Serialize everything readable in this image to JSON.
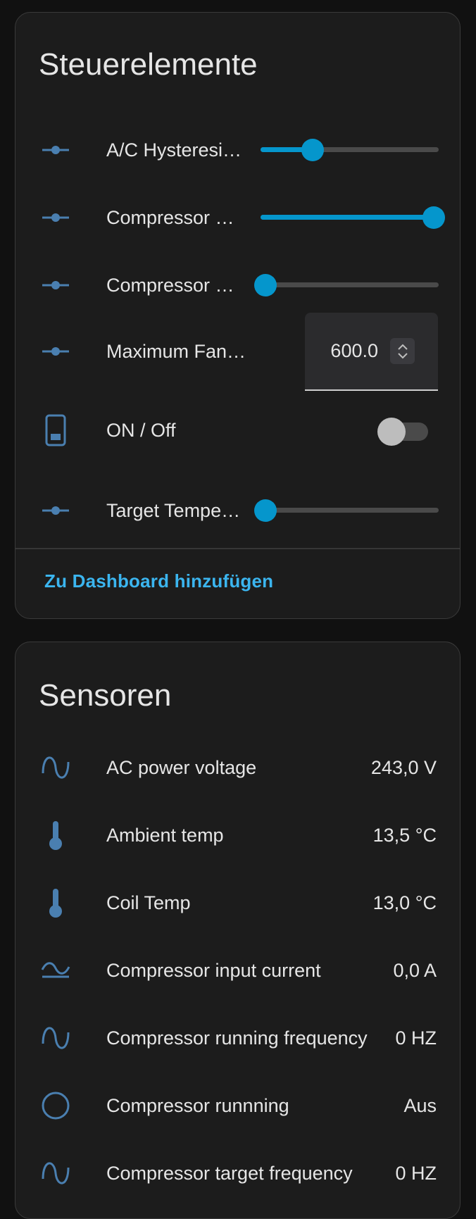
{
  "colors": {
    "accent": "#0596cc",
    "link": "#3bb5ef",
    "icon": "#4a7fb0",
    "card_bg": "#1c1c1c",
    "page_bg": "#111111"
  },
  "controls": {
    "title": "Steuerelemente",
    "items": [
      {
        "label": "A/C Hysteresi…",
        "type": "slider",
        "icon": "slider-icon",
        "level": 0.28
      },
      {
        "label": "Compressor …",
        "type": "slider",
        "icon": "slider-icon",
        "level": 1.0
      },
      {
        "label": "Compressor …",
        "type": "slider",
        "icon": "slider-icon",
        "level": 0.0
      },
      {
        "label": "Maximum Fan…",
        "type": "number",
        "icon": "slider-icon",
        "value": "600.0"
      },
      {
        "label": "ON / Off",
        "type": "toggle",
        "icon": "phone-icon",
        "state": "off"
      },
      {
        "label": "Target Tempe…",
        "type": "slider",
        "icon": "slider-icon",
        "level": 0.0
      }
    ],
    "action_label": "Zu Dashboard hinzufügen"
  },
  "sensors": {
    "title": "Sensoren",
    "items": [
      {
        "label": "AC power voltage",
        "value": "243,0 V",
        "icon": "sine-wave-icon"
      },
      {
        "label": "Ambient temp",
        "value": "13,5 °C",
        "icon": "thermometer-icon"
      },
      {
        "label": "Coil Temp",
        "value": "13,0 °C",
        "icon": "thermometer-icon"
      },
      {
        "label": "Compressor input current",
        "value": "0,0 A",
        "icon": "current-ac-icon"
      },
      {
        "label": "Compressor running frequency",
        "value": "0 HZ",
        "icon": "sine-wave-icon"
      },
      {
        "label": "Compressor runnning",
        "value": "Aus",
        "icon": "circle-outline-icon"
      },
      {
        "label": "Compressor target frequency",
        "value": "0 HZ",
        "icon": "sine-wave-icon"
      }
    ]
  }
}
